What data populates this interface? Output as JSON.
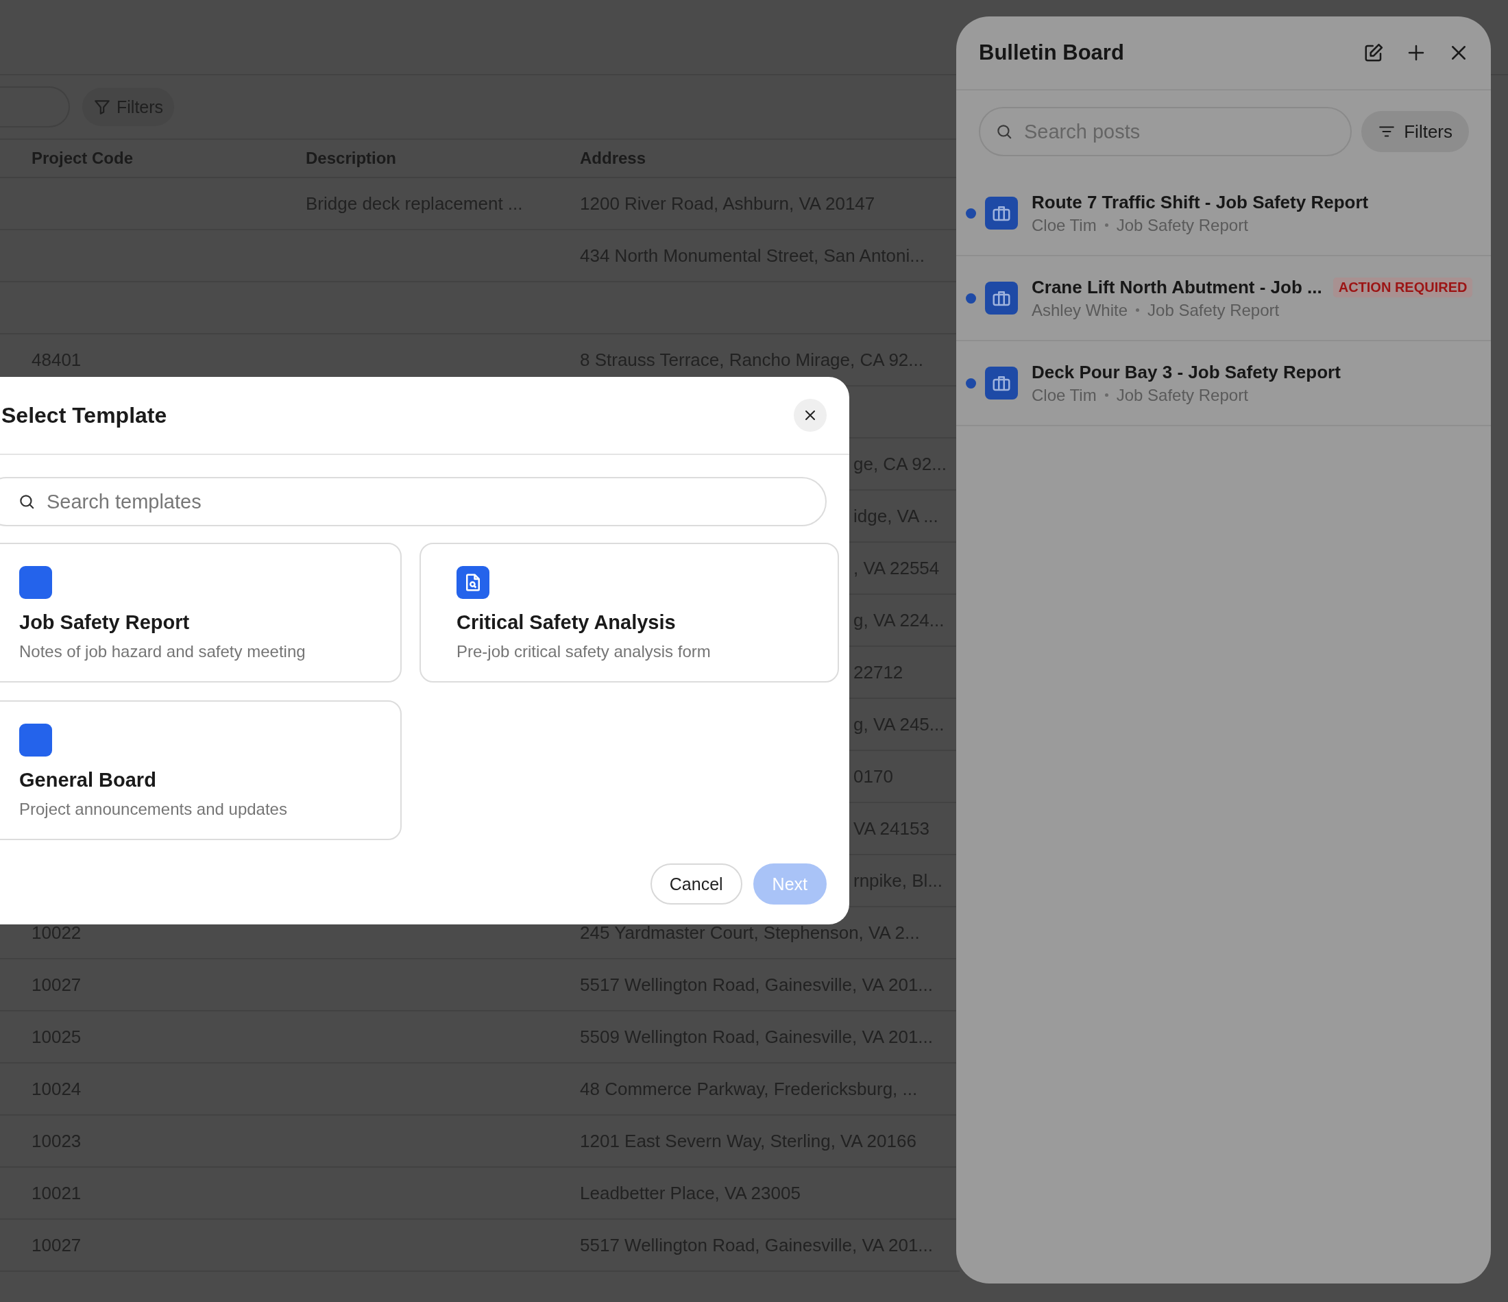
{
  "toolbar": {
    "filters_button": "Filters"
  },
  "table": {
    "columns": [
      "Project Code",
      "Description",
      "Address"
    ],
    "rows": [
      {
        "description": "Bridge deck replacement ...",
        "address": "1200 River Road, Ashburn, VA 20147"
      },
      {
        "address": "434 North Monumental Street, San Antoni..."
      },
      {},
      {
        "project_code": "48401",
        "address": "8 Strauss Terrace, Rancho Mirage, CA 92..."
      },
      {},
      {
        "address": "ge, CA 92...",
        "clipped": true
      },
      {
        "address": "idge, VA ...",
        "clipped": true
      },
      {
        "address": ", VA 22554",
        "clipped": true
      },
      {
        "address": "g, VA 224...",
        "clipped": true
      },
      {
        "address": "22712",
        "clipped": true
      },
      {
        "address": "g, VA 245...",
        "clipped": true
      },
      {
        "address": "0170",
        "clipped": true
      },
      {
        "address": "VA 24153",
        "clipped": true
      },
      {
        "address": "rnpike, Bl...",
        "clipped": true
      },
      {
        "project_code": "10022",
        "address": "245 Yardmaster Court, Stephenson, VA 2..."
      },
      {
        "project_code": "10027",
        "address": "5517 Wellington Road, Gainesville, VA 201..."
      },
      {
        "project_code": "10025",
        "address": "5509 Wellington Road, Gainesville, VA 201..."
      },
      {
        "project_code": "10024",
        "address": "48 Commerce Parkway, Fredericksburg, ..."
      },
      {
        "project_code": "10023",
        "address": "1201 East Severn Way, Sterling, VA 20166"
      },
      {
        "project_code": "10021",
        "address": "Leadbetter Place, VA 23005"
      },
      {
        "project_code": "10027",
        "address": "5517 Wellington Road, Gainesville, VA 201..."
      },
      {}
    ]
  },
  "bulletin_board": {
    "title": "Bulletin Board",
    "search": {
      "placeholder": "Search posts"
    },
    "filters_button": "Filters",
    "posts": [
      {
        "title": "Route 7 Traffic Shift - Job Safety Report",
        "author": "Cloe Tim",
        "type": "Job Safety Report",
        "unread": true
      },
      {
        "title": "Crane Lift North Abutment - Job ...",
        "author": "Ashley White",
        "type": "Job Safety Report",
        "unread": true,
        "badge": "ACTION REQUIRED"
      },
      {
        "title": "Deck Pour Bay 3 - Job Safety Report",
        "author": "Cloe Tim",
        "type": "Job Safety Report",
        "unread": true
      }
    ]
  },
  "modal": {
    "title": "Select Template",
    "search": {
      "placeholder": "Search templates"
    },
    "templates": [
      {
        "kind": "blank",
        "title": "Job Safety Report",
        "description": "Notes of job hazard and safety meeting"
      },
      {
        "kind": "document",
        "title": "Critical Safety Analysis",
        "description": "Pre-job critical safety analysis form"
      },
      {
        "kind": "blank",
        "title": "General Board",
        "description": "Project announcements and updates"
      }
    ],
    "buttons": [
      {
        "label": "Cancel",
        "kind": "secondary",
        "disabled": false
      },
      {
        "label": "Next",
        "kind": "primary",
        "disabled": true
      }
    ]
  }
}
